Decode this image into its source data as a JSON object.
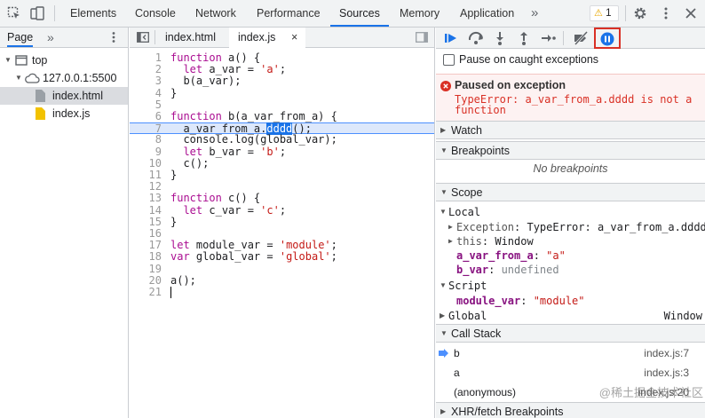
{
  "toolbar": {
    "tabs": [
      "Elements",
      "Console",
      "Network",
      "Performance",
      "Sources",
      "Memory",
      "Application"
    ],
    "more_tabs": "»",
    "warnings_count": "1"
  },
  "navigator": {
    "tab_label": "Page",
    "more": "»",
    "tree": {
      "top": "top",
      "host": "127.0.0.1:5500",
      "files": [
        "index.html",
        "index.js"
      ]
    }
  },
  "editor": {
    "tabs": [
      "index.html",
      "index.js"
    ],
    "close_glyph": "×",
    "lines": [
      {
        "n": "1",
        "t": "function a() {"
      },
      {
        "n": "2",
        "t": "  let a_var = 'a';"
      },
      {
        "n": "3",
        "t": "  b(a_var);"
      },
      {
        "n": "4",
        "t": "}"
      },
      {
        "n": "5",
        "t": ""
      },
      {
        "n": "6",
        "t": "function b(a_var_from_a) {"
      },
      {
        "n": "7",
        "t": "  a_var_from_a.dddd();"
      },
      {
        "n": "8",
        "t": "  console.log(global_var);"
      },
      {
        "n": "9",
        "t": "  let b_var = 'b';"
      },
      {
        "n": "10",
        "t": "  c();"
      },
      {
        "n": "11",
        "t": "}"
      },
      {
        "n": "12",
        "t": ""
      },
      {
        "n": "13",
        "t": "function c() {"
      },
      {
        "n": "14",
        "t": "  let c_var = 'c';"
      },
      {
        "n": "15",
        "t": "}"
      },
      {
        "n": "16",
        "t": ""
      },
      {
        "n": "17",
        "t": "let module_var = 'module';"
      },
      {
        "n": "18",
        "t": "var global_var = 'global';"
      },
      {
        "n": "19",
        "t": ""
      },
      {
        "n": "20",
        "t": "a();"
      },
      {
        "n": "21",
        "t": ""
      }
    ]
  },
  "debugger": {
    "pause_on_caught_label": "Pause on caught exceptions",
    "paused": {
      "title": "Paused on exception",
      "message": "TypeError: a_var_from_a.dddd is not a function"
    },
    "sections": {
      "watch": "Watch",
      "breakpoints": "Breakpoints",
      "no_breakpoints": "No breakpoints",
      "scope": "Scope",
      "call_stack": "Call Stack",
      "xhr": "XHR/fetch Breakpoints"
    },
    "scope": {
      "local": "Local",
      "exception_key": "Exception",
      "exception_val": "TypeError: a_var_from_a.dddd",
      "this_key": "this",
      "this_val": "Window",
      "a_var_from_a_key": "a_var_from_a",
      "a_var_from_a_val": "\"a\"",
      "b_var_key": "b_var",
      "b_var_val": "undefined",
      "script": "Script",
      "module_var_key": "module_var",
      "module_var_val": "\"module\"",
      "global": "Global",
      "global_val": "Window"
    },
    "call_stack": [
      {
        "fn": "b",
        "loc": "index.js:7"
      },
      {
        "fn": "a",
        "loc": "index.js:3"
      },
      {
        "fn": "(anonymous)",
        "loc": "index.js:20"
      }
    ]
  },
  "watermark": "@稀土掘金技术社区",
  "colors": {
    "accent": "#1a73e8",
    "error_bg": "#fdf2f2",
    "error_text": "#d93025",
    "highlight_line": "#dde8fb"
  }
}
